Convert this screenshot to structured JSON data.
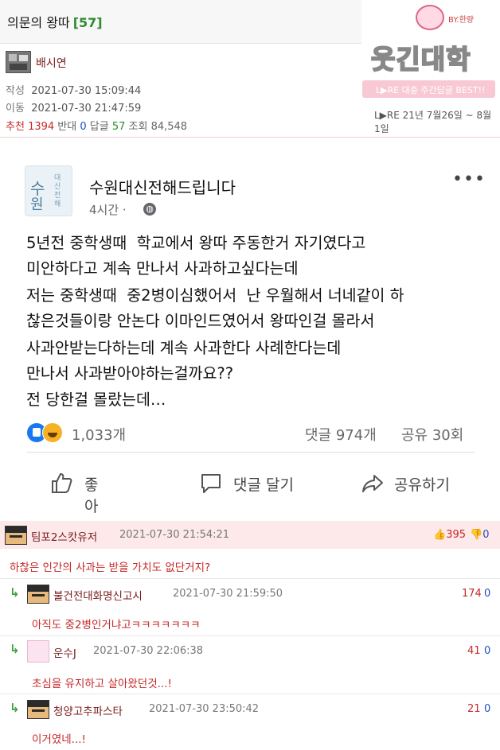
{
  "post": {
    "title": "의문의 왕따",
    "comment_count_bracket": "[57]",
    "author": "배시연",
    "written_label": "작성",
    "written_date": "2021-07-30 15:09:44",
    "moved_label": "이동",
    "moved_date": "2021-07-30 21:47:59",
    "stats": {
      "recommend_label": "추천",
      "recommend": "1394",
      "oppose_label": "반대",
      "oppose": "0",
      "replies_label": "답글",
      "replies": "57",
      "views_label": "조회",
      "views": "84,548"
    }
  },
  "logo": {
    "title": "웃긴대학",
    "by": "BY.한량",
    "banner": "L▶RE   대충 주간답글 BEST!!",
    "date_range": "L▶RE  21년 7월26일 ~ 8월 1일"
  },
  "fb_post": {
    "page_name": "수원대신전해드립니다",
    "time": "4시간 ·",
    "more": "•••",
    "logo_main": [
      "수",
      "원"
    ],
    "logo_side": "대신전해",
    "body_lines": [
      "5년전 중학생때  학교에서 왕따 주동한거 자기였다고",
      "미안하다고 계속 만나서 사과하고싶다는데",
      "저는 중학생때  중2병이심했어서  난 우월해서 너네같이 하",
      "찮은것들이랑 안논다 이마인드였어서 왕따인걸 몰라서",
      "사과안받는다하는데 계속 사과한다 사례한다는데",
      "만나서 사과받아야하는걸까요??",
      "전 당한걸 몰랐는데…"
    ],
    "reactions": "1,033개",
    "comments": "댓글 974개",
    "shares": "공유 30회",
    "actions": {
      "like": "좋아요",
      "comment": "댓글 달기",
      "share": "공유하기"
    }
  },
  "comments": [
    {
      "name": "팀포2스캇유저",
      "date": "2021-07-30 21:54:21",
      "up": "395",
      "down": "0",
      "text": "하찮은 인간의 사과는 받을 가치도 없단거지?"
    },
    {
      "name": "불건전대화명신고시",
      "date": "2021-07-30 21:59:50",
      "up": "174",
      "down": "0",
      "text": "아직도 중2병인거냐고ㅋㅋㅋㅋㅋㅋㅋ"
    },
    {
      "name": "운수J",
      "date": "2021-07-30 22:06:38",
      "up": "41",
      "down": "0",
      "text": "초심을 유지하고 살아왔던것...!"
    },
    {
      "name": "청양고추파스타",
      "date": "2021-07-30 23:50:42",
      "up": "21",
      "down": "0",
      "text": "이거였네...!"
    }
  ],
  "colors": {
    "accent_red": "#c62828",
    "facebook_blue": "#1877f2",
    "comment_header_bg": "#fde9ea"
  }
}
